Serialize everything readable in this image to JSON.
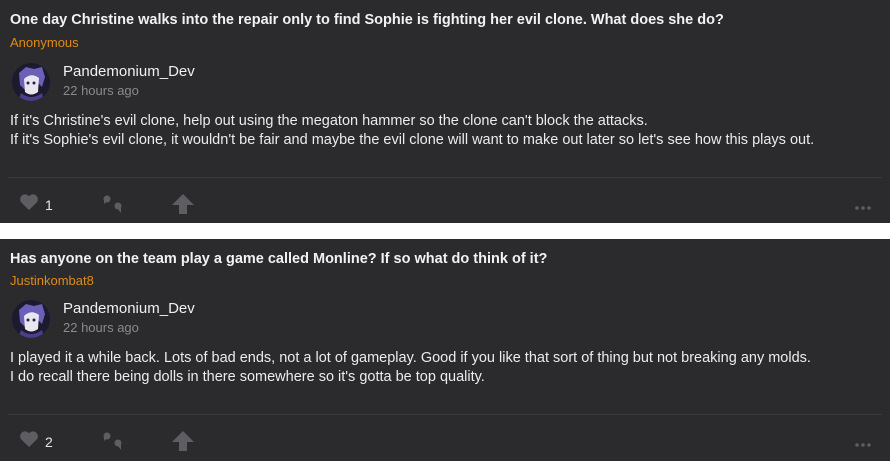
{
  "posts": [
    {
      "question": "One day Christine walks into the repair only to find Sophie is fighting her evil clone. What does she do?",
      "asker": "Anonymous",
      "author": "Pandemonium_Dev",
      "time": "22 hours ago",
      "lines": [
        "If it's Christine's evil clone, help out using the megaton hammer so the clone can't block the attacks.",
        "If it's Sophie's evil clone, it wouldn't be fair and maybe the evil clone will want to make out later so let's see how this plays out."
      ],
      "likes": "1"
    },
    {
      "question": "Has anyone on the team play a game called Monline? If so what do think of it?",
      "asker": "Justinkombat8",
      "author": "Pandemonium_Dev",
      "time": "22 hours ago",
      "lines": [
        "I played it a while back. Lots of bad ends, not a lot of gameplay. Good if you like that sort of thing but not breaking any molds.",
        "I do recall there being dolls in there somewhere so it's gotta be top quality."
      ],
      "likes": "2"
    }
  ],
  "colors": {
    "card_bg": "#2b2a2d",
    "asker": "#e08a17",
    "muted": "#8a898d",
    "icon": "#5e5d62"
  },
  "icons": {
    "like": "heart-icon",
    "quote": "quote-icon",
    "upvote": "upvote-arrow-icon",
    "more": "more-dots-icon"
  }
}
